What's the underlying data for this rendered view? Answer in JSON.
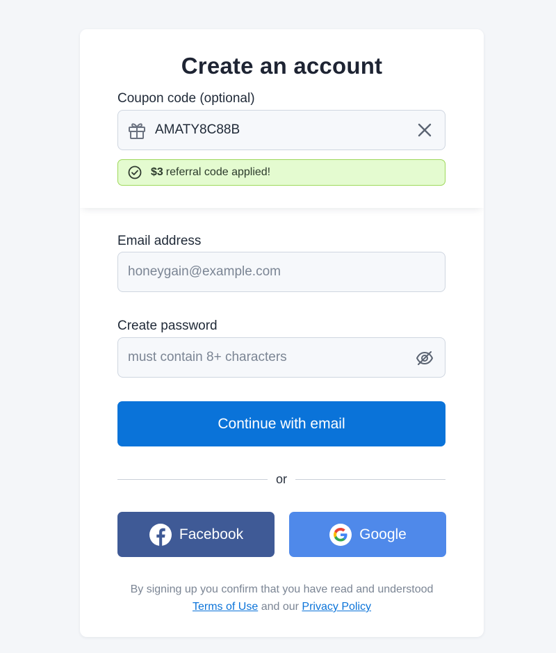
{
  "page": {
    "title": "Create an account"
  },
  "coupon": {
    "label": "Coupon code (optional)",
    "value": "AMATY8C88B",
    "icon": "gift-icon",
    "clear_icon": "close-icon"
  },
  "success": {
    "amount": "$3",
    "message": "referral code applied!",
    "icon": "check-circle-icon"
  },
  "email": {
    "label": "Email address",
    "placeholder": "honeygain@example.com"
  },
  "password": {
    "label": "Create password",
    "placeholder": "must contain 8+ characters",
    "toggle_icon": "eye-slash-icon"
  },
  "actions": {
    "continue_label": "Continue with email",
    "divider_text": "or",
    "facebook_label": "Facebook",
    "google_label": "Google"
  },
  "legal": {
    "text": "By signing up you confirm that you have read and understood",
    "terms_label": "Terms of Use",
    "connector": "and our",
    "privacy_label": "Privacy Policy"
  },
  "colors": {
    "primary": "#0a73d9",
    "facebook": "#3f5a96",
    "google": "#4f89ea",
    "success_bg": "#e4fbd0",
    "success_border": "#9ed85a",
    "background": "#f4f6f9"
  }
}
